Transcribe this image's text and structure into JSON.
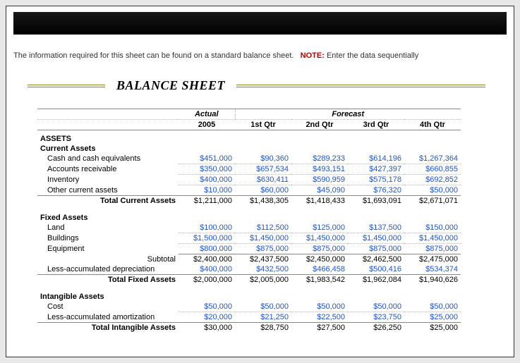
{
  "info": {
    "prefix": "The information required for this sheet can be found on a standard balance sheet.",
    "note_label": "NOTE:",
    "note_text": "Enter the data sequentially"
  },
  "title": "BALANCE  SHEET",
  "headers": {
    "actual": "Actual",
    "forecast": "Forecast",
    "year": "2005",
    "q1": "1st Qtr",
    "q2": "2nd Qtr",
    "q3": "3rd Qtr",
    "q4": "4th Qtr"
  },
  "assets": {
    "label": "ASSETS",
    "current": {
      "label": "Current Assets",
      "rows": [
        {
          "label": "Cash and cash equivalents",
          "actual": "$451,000",
          "q1": "$90,360",
          "q2": "$289,233",
          "q3": "$614,196",
          "q4": "$1,267,364"
        },
        {
          "label": "Accounts receivable",
          "actual": "$350,000",
          "q1": "$657,534",
          "q2": "$493,151",
          "q3": "$427,397",
          "q4": "$660,855"
        },
        {
          "label": "Inventory",
          "actual": "$400,000",
          "q1": "$630,411",
          "q2": "$590,959",
          "q3": "$575,178",
          "q4": "$692,852"
        },
        {
          "label": "Other current assets",
          "actual": "$10,000",
          "q1": "$60,000",
          "q2": "$45,090",
          "q3": "$76,320",
          "q4": "$50,000"
        }
      ],
      "total": {
        "label": "Total Current Assets",
        "actual": "$1,211,000",
        "q1": "$1,438,305",
        "q2": "$1,418,433",
        "q3": "$1,693,091",
        "q4": "$2,671,071"
      }
    },
    "fixed": {
      "label": "Fixed Assets",
      "rows": [
        {
          "label": "Land",
          "actual": "$100,000",
          "q1": "$112,500",
          "q2": "$125,000",
          "q3": "$137,500",
          "q4": "$150,000"
        },
        {
          "label": "Buildings",
          "actual": "$1,500,000",
          "q1": "$1,450,000",
          "q2": "$1,450,000",
          "q3": "$1,450,000",
          "q4": "$1,450,000"
        },
        {
          "label": "Equipment",
          "actual": "$800,000",
          "q1": "$875,000",
          "q2": "$875,000",
          "q3": "$875,000",
          "q4": "$875,000"
        }
      ],
      "subtotal": {
        "label": "Subtotal",
        "actual": "$2,400,000",
        "q1": "$2,437,500",
        "q2": "$2,450,000",
        "q3": "$2,462,500",
        "q4": "$2,475,000"
      },
      "less_dep": {
        "label": "Less-accumulated depreciation",
        "actual": "$400,000",
        "q1": "$432,500",
        "q2": "$466,458",
        "q3": "$500,416",
        "q4": "$534,374"
      },
      "total": {
        "label": "Total Fixed Assets",
        "actual": "$2,000,000",
        "q1": "$2,005,000",
        "q2": "$1,983,542",
        "q3": "$1,962,084",
        "q4": "$1,940,626"
      }
    },
    "intangible": {
      "label": "Intangible Assets",
      "rows": [
        {
          "label": "Cost",
          "actual": "$50,000",
          "q1": "$50,000",
          "q2": "$50,000",
          "q3": "$50,000",
          "q4": "$50,000"
        }
      ],
      "less_amort": {
        "label": "Less-accumulated amortization",
        "actual": "$20,000",
        "q1": "$21,250",
        "q2": "$22,500",
        "q3": "$23,750",
        "q4": "$25,000"
      },
      "total": {
        "label": "Total Intangible Assets",
        "actual": "$30,000",
        "q1": "$28,750",
        "q2": "$27,500",
        "q3": "$26,250",
        "q4": "$25,000"
      }
    }
  },
  "chart_data": {
    "type": "table",
    "title": "Balance Sheet — Assets",
    "columns": [
      "Actual 2005",
      "1st Qtr",
      "2nd Qtr",
      "3rd Qtr",
      "4th Qtr"
    ],
    "sections": [
      {
        "name": "Current Assets",
        "rows": {
          "Cash and cash equivalents": [
            451000,
            90360,
            289233,
            614196,
            1267364
          ],
          "Accounts receivable": [
            350000,
            657534,
            493151,
            427397,
            660855
          ],
          "Inventory": [
            400000,
            630411,
            590959,
            575178,
            692852
          ],
          "Other current assets": [
            10000,
            60000,
            45090,
            76320,
            50000
          ]
        },
        "total": [
          1211000,
          1438305,
          1418433,
          1693091,
          2671071
        ]
      },
      {
        "name": "Fixed Assets",
        "rows": {
          "Land": [
            100000,
            112500,
            125000,
            137500,
            150000
          ],
          "Buildings": [
            1500000,
            1450000,
            1450000,
            1450000,
            1450000
          ],
          "Equipment": [
            800000,
            875000,
            875000,
            875000,
            875000
          ]
        },
        "subtotal": [
          2400000,
          2437500,
          2450000,
          2462500,
          2475000
        ],
        "less_accumulated_depreciation": [
          400000,
          432500,
          466458,
          500416,
          534374
        ],
        "total": [
          2000000,
          2005000,
          1983542,
          1962084,
          1940626
        ]
      },
      {
        "name": "Intangible Assets",
        "rows": {
          "Cost": [
            50000,
            50000,
            50000,
            50000,
            50000
          ]
        },
        "less_accumulated_amortization": [
          20000,
          21250,
          22500,
          23750,
          25000
        ],
        "total": [
          30000,
          28750,
          27500,
          26250,
          25000
        ]
      }
    ]
  }
}
